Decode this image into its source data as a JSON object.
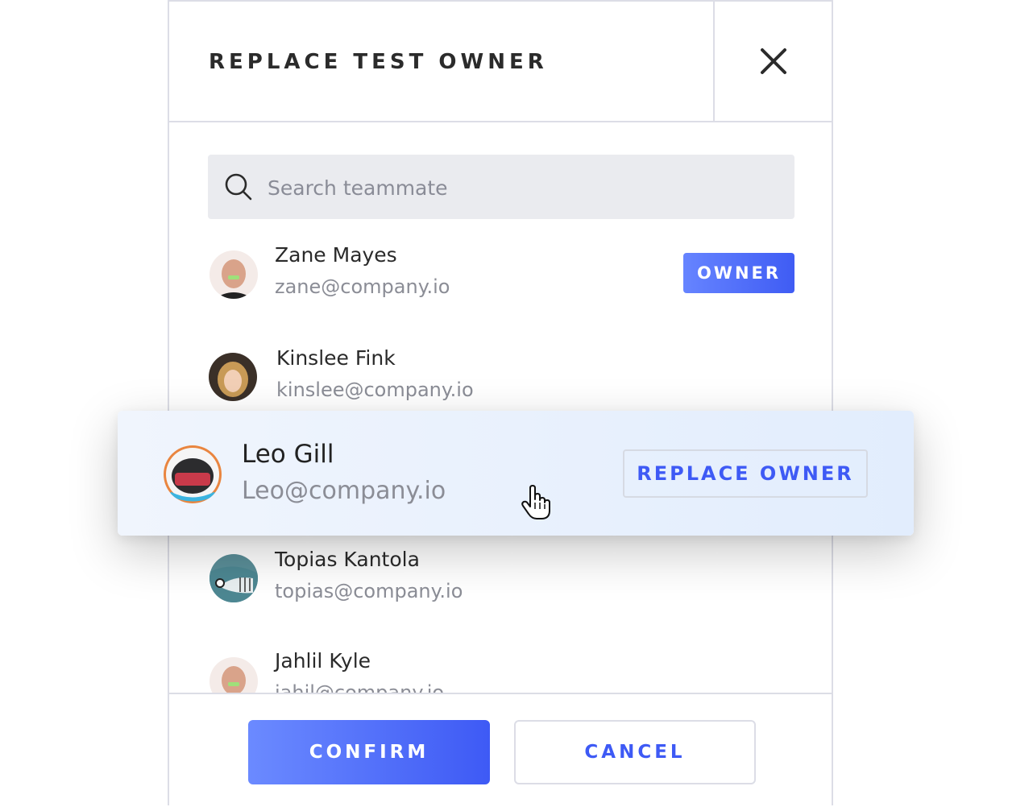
{
  "dialog": {
    "title": "REPLACE TEST OWNER",
    "close_icon": "close-icon"
  },
  "search": {
    "placeholder": "Search teammate",
    "icon": "search-icon"
  },
  "members": [
    {
      "name": "Zane Mayes",
      "email": "zane@company.io",
      "badge": "OWNER"
    },
    {
      "name": "Kinslee Fink",
      "email": "kinslee@company.io"
    },
    {
      "name": "Topias Kantola",
      "email": "topias@company.io"
    },
    {
      "name": "Jahlil Kyle",
      "email": "jahil@company.io"
    }
  ],
  "hovered_member": {
    "name": "Leo Gill",
    "email": "Leo@company.io",
    "action_label": "REPLACE OWNER"
  },
  "footer": {
    "confirm_label": "CONFIRM",
    "cancel_label": "CANCEL"
  },
  "colors": {
    "accent": "#3e5af5",
    "accent_light": "#6b8aff",
    "border": "#dcdde6",
    "search_bg": "#eaebef",
    "hover_bg": "#e8f0fd"
  }
}
